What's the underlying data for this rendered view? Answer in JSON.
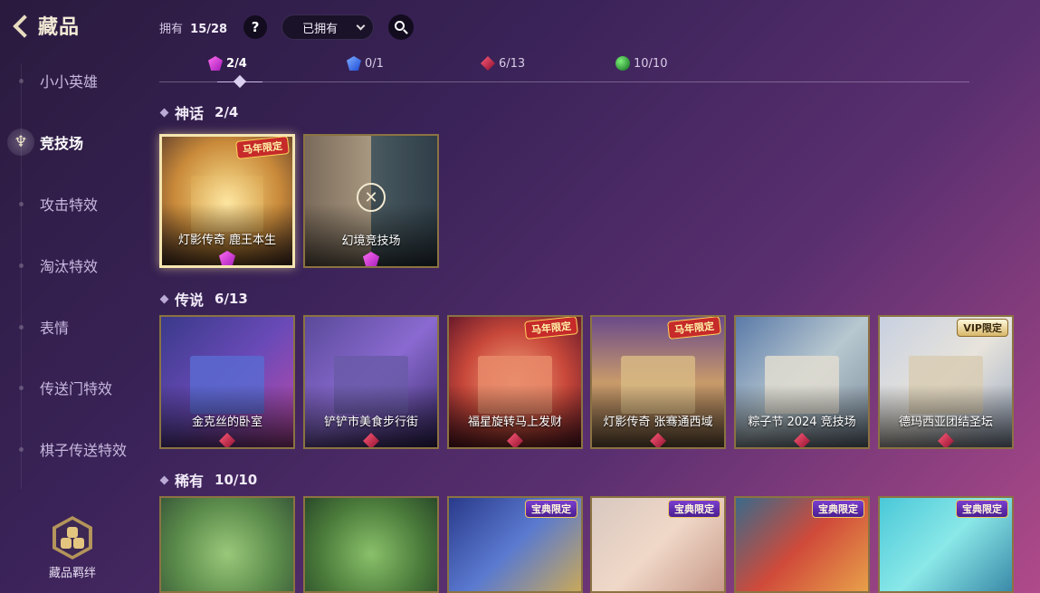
{
  "header": {
    "title": "藏品"
  },
  "sidebar": {
    "items": [
      {
        "label": "小小英雄"
      },
      {
        "label": "竞技场"
      },
      {
        "label": "攻击特效"
      },
      {
        "label": "淘汰特效"
      },
      {
        "label": "表情"
      },
      {
        "label": "传送门特效"
      },
      {
        "label": "棋子传送特效"
      }
    ],
    "bond_label": "藏品羁绊"
  },
  "topbar": {
    "owned_label": "拥有",
    "owned_count": "15/28",
    "help_label": "?",
    "filter_value": "已拥有"
  },
  "rarity_tabs": [
    {
      "count": "2/4"
    },
    {
      "count": "0/1"
    },
    {
      "count": "6/13"
    },
    {
      "count": "10/10"
    }
  ],
  "sections": [
    {
      "title": "神话",
      "count": "2/4",
      "cards": [
        {
          "name": "灯影传奇  鹿王本生",
          "tag": "马年限定"
        },
        {
          "name": "幻境竞技场"
        }
      ]
    },
    {
      "title": "传说",
      "count": "6/13",
      "cards": [
        {
          "name": "金克丝的卧室"
        },
        {
          "name": "铲铲市美食步行街"
        },
        {
          "name": "福星旋转马上发财",
          "tag": "马年限定"
        },
        {
          "name": "灯影传奇  张骞通西域",
          "tag": "马年限定"
        },
        {
          "name": "粽子节  2024  竞技场"
        },
        {
          "name": "德玛西亚团结圣坛",
          "tag": "VIP限定"
        }
      ]
    },
    {
      "title": "稀有",
      "count": "10/10",
      "cards": [
        {},
        {},
        {
          "tag": "宝典限定"
        },
        {
          "tag": "宝典限定"
        },
        {
          "tag": "宝典限定"
        },
        {
          "tag": "宝典限定"
        }
      ]
    }
  ],
  "colors": {
    "mythic_gem": "#c43ad8",
    "sapphire_gem": "#3a6ae8",
    "ruby_gem": "#c0203e",
    "emerald_gem": "#2aa83a",
    "card_border": "#8b7342",
    "selected_border": "#f5e6b0"
  }
}
